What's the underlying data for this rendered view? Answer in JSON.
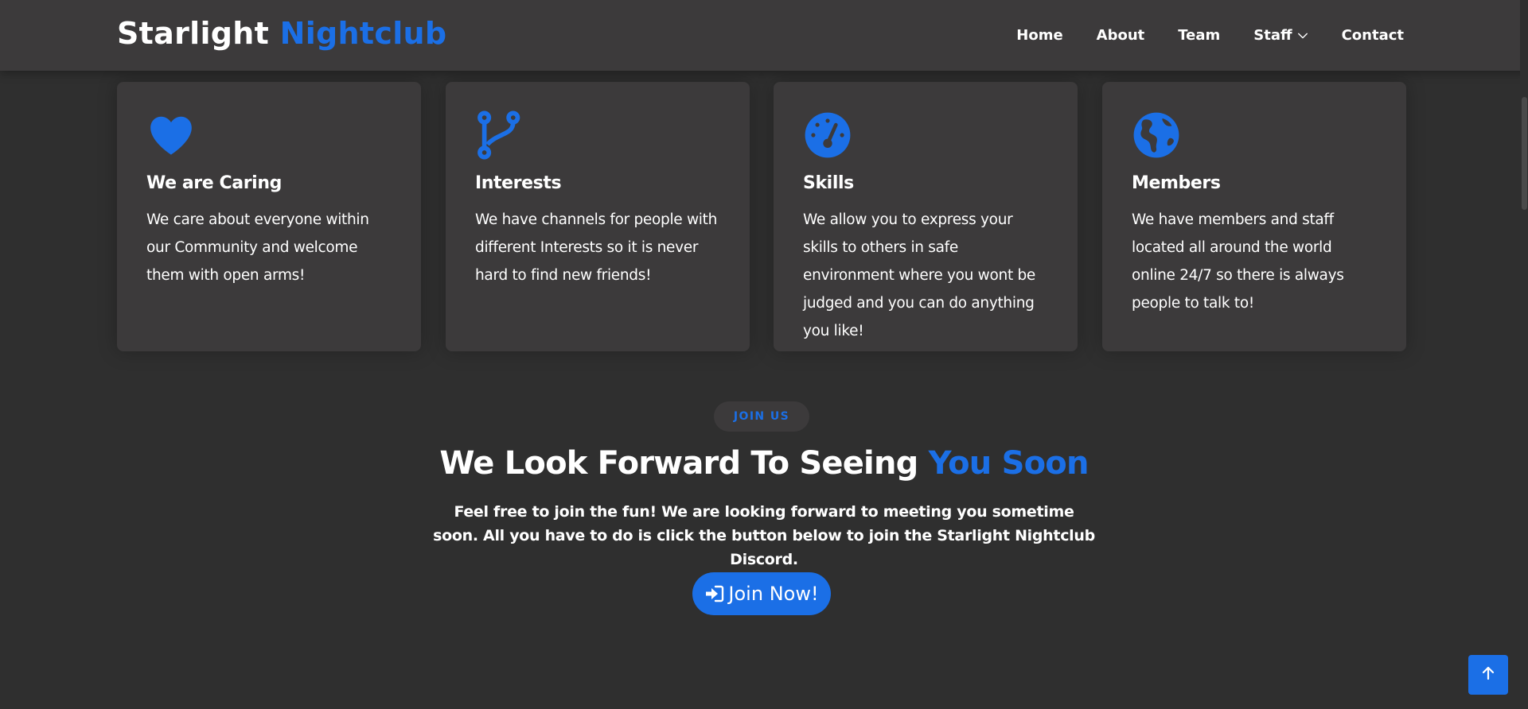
{
  "header": {
    "logo_main": "Starlight",
    "logo_accent": "Nightclub",
    "nav": {
      "home": "Home",
      "about": "About",
      "team": "Team",
      "staff": "Staff",
      "contact": "Contact"
    }
  },
  "features": [
    {
      "icon": "heart-icon",
      "title": "We are Caring",
      "text": "We care about everyone within our Community and welcome them with open arms!"
    },
    {
      "icon": "git-branch-icon",
      "title": "Interests",
      "text": "We have channels for people with different Interests so it is never hard to find new friends!"
    },
    {
      "icon": "speedometer-icon",
      "title": "Skills",
      "text": "We allow you to express your skills to others in safe environment where you wont be judged and you can do anything you like!"
    },
    {
      "icon": "globe-icon",
      "title": "Members",
      "text": "We have members and staff located all around the world online 24/7 so there is always people to talk to!"
    }
  ],
  "join": {
    "badge": "JOIN US",
    "title_main": "We Look Forward To Seeing",
    "title_accent": "You Soon",
    "description": "Feel free to join the fun! We are looking forward to meeting you sometime soon. All you have to do is click the button below to join the Starlight Nightclub Discord.",
    "button_label": "Join Now!",
    "button_icon": "sign-in-icon"
  },
  "back_to_top_icon": "arrow-up-icon",
  "colors": {
    "accent": "#1b6fe6",
    "background": "#2f2f2f",
    "card": "#3c3a3b",
    "text": "#ffffff"
  }
}
